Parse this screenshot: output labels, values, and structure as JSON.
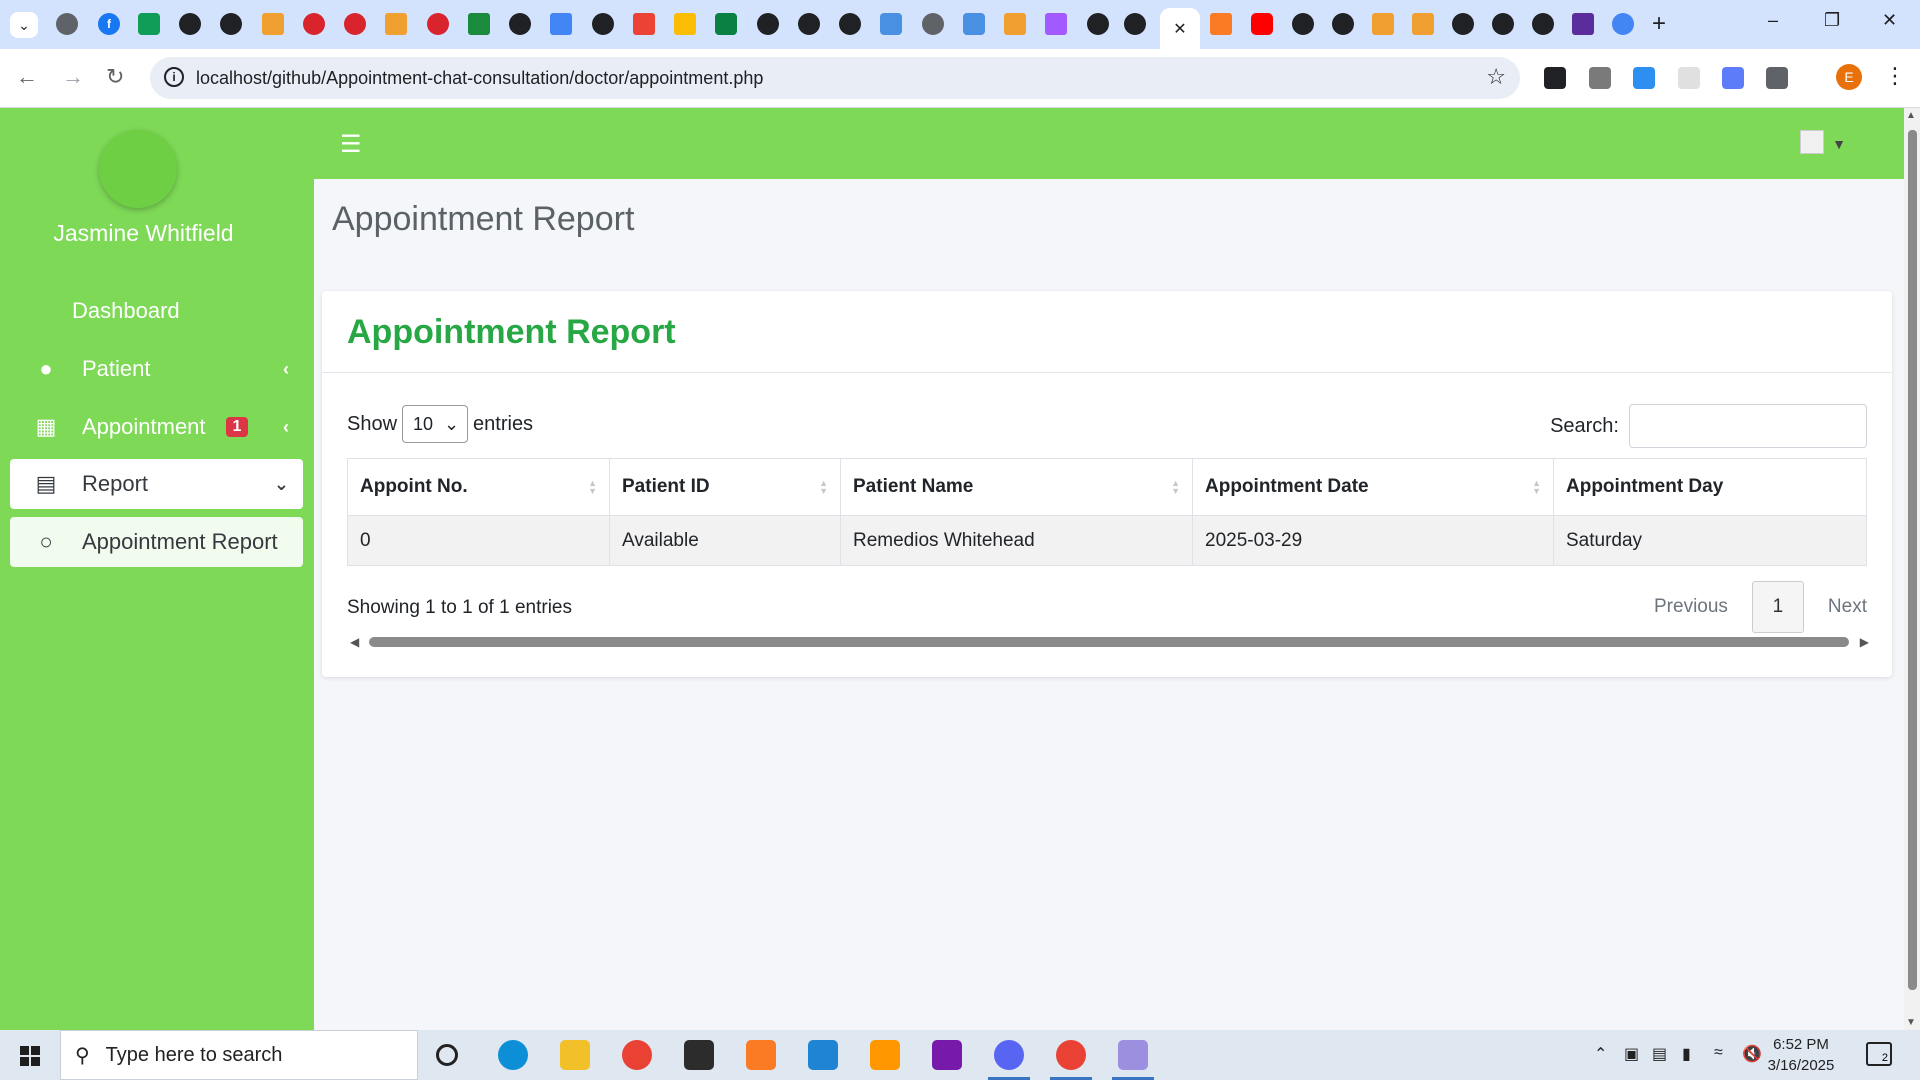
{
  "browser": {
    "url": "localhost/github/Appointment-chat-consultation/doctor/appointment.php",
    "profile_initial": "E",
    "tab_close": "✕"
  },
  "sidebar": {
    "user_name": "Jasmine Whitfield",
    "items": [
      {
        "label": "Dashboard",
        "icon": "gauge-icon"
      },
      {
        "label": "Patient",
        "icon": "user-icon"
      },
      {
        "label": "Appointment",
        "icon": "calendar-icon",
        "badge": "1"
      },
      {
        "label": "Report",
        "icon": "monitor-icon",
        "expanded": true
      },
      {
        "label": "Appointment Report",
        "icon": "circle-icon",
        "active": true
      }
    ]
  },
  "content": {
    "page_title": "Appointment Report",
    "card_title": "Appointment Report",
    "show_label": "Show",
    "entries_value": "10",
    "entries_label": "entries",
    "search_label": "Search:",
    "columns": [
      "Appoint No.",
      "Patient ID",
      "Patient Name",
      "Appointment Date",
      "Appointment Day"
    ],
    "rows": [
      [
        "0",
        "Available",
        "Remedios Whitehead",
        "2025-03-29",
        "Saturday"
      ]
    ],
    "info": "Showing 1 to 1 of 1 entries",
    "pagination": {
      "previous": "Previous",
      "current": "1",
      "next": "Next"
    }
  },
  "taskbar": {
    "search_placeholder": "Type here to search",
    "time": "6:52 PM",
    "date": "3/16/2025",
    "notification_count": "2"
  },
  "colors": {
    "sidebar_green": "#7ed957",
    "title_green": "#28a745",
    "badge_red": "#dc3545"
  }
}
